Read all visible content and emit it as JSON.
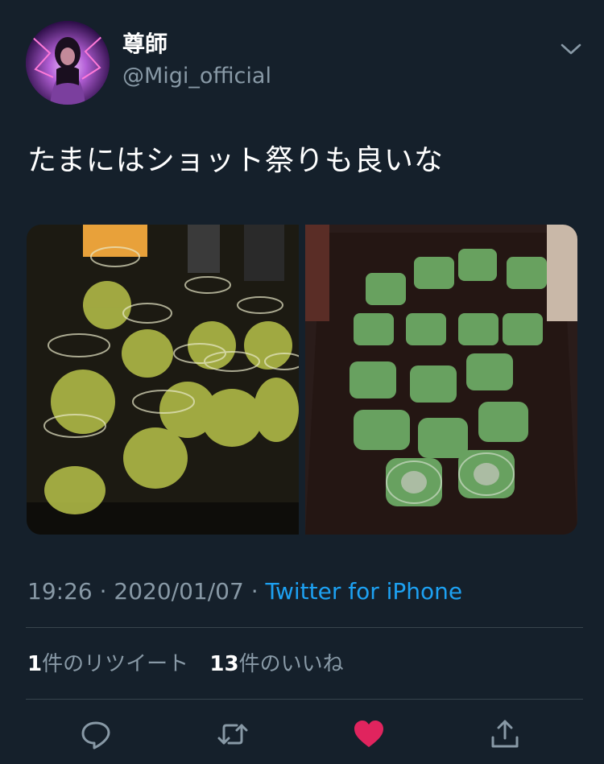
{
  "author": {
    "display_name": "尊師",
    "handle": "@Migi_official",
    "avatar_icon": "user-avatar"
  },
  "tweet": {
    "text": "たまにはショット祭りも良いな"
  },
  "media": {
    "count": 2,
    "photos": [
      {
        "icon": "photo-shot-glasses-1"
      },
      {
        "icon": "photo-shot-glasses-2"
      }
    ]
  },
  "meta": {
    "time": "19:26",
    "separator1": " · ",
    "date": "2020/01/07",
    "separator2": " · ",
    "source": "Twitter for iPhone"
  },
  "stats": {
    "retweets_count": "1",
    "retweets_label": "件のリツイート",
    "likes_count": "13",
    "likes_label": "件のいいね"
  },
  "actions": {
    "reply_icon": "reply-icon",
    "retweet_icon": "retweet-icon",
    "like_icon": "heart-icon",
    "share_icon": "share-icon",
    "liked": true
  },
  "colors": {
    "background": "#15202b",
    "text_primary": "#ffffff",
    "text_secondary": "#8899a6",
    "link": "#1da1f2",
    "like": "#e0245e",
    "divider": "#38444d"
  }
}
